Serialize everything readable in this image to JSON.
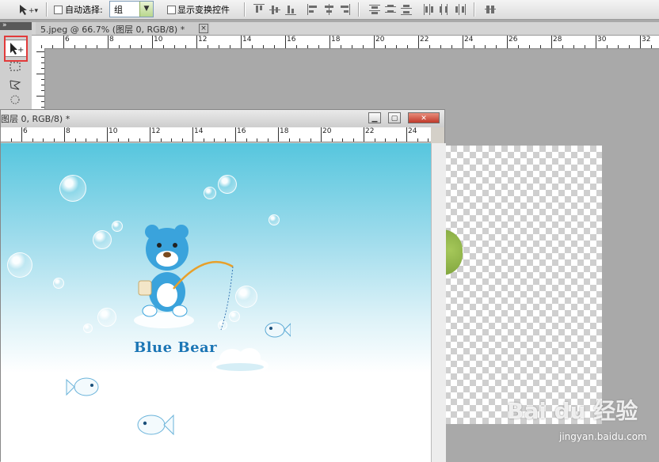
{
  "options_bar": {
    "auto_select_label": "自动选择:",
    "auto_select_value": "组",
    "show_transform_label": "显示变换控件"
  },
  "document": {
    "tab_title": "5.jpeg @ 66.7% (图层 0, RGB/8) *",
    "tab_close": "×",
    "window_title": "图层 0, RGB/8) *"
  },
  "rulers": {
    "top_labels": [
      "6",
      "8",
      "10",
      "12",
      "14",
      "16",
      "18",
      "20",
      "22",
      "24",
      "26",
      "28",
      "30",
      "32"
    ],
    "window_labels": [
      "6",
      "8",
      "10",
      "12",
      "14",
      "16",
      "18",
      "20",
      "22",
      "24"
    ]
  },
  "canvas": {
    "logo_text": "Blue Bear"
  },
  "watermark": {
    "brand": "Bai du 经验",
    "url": "jingyan.baidu.com"
  },
  "window_buttons": {
    "minimize": "▁",
    "maximize": "▢",
    "close": "✕"
  }
}
